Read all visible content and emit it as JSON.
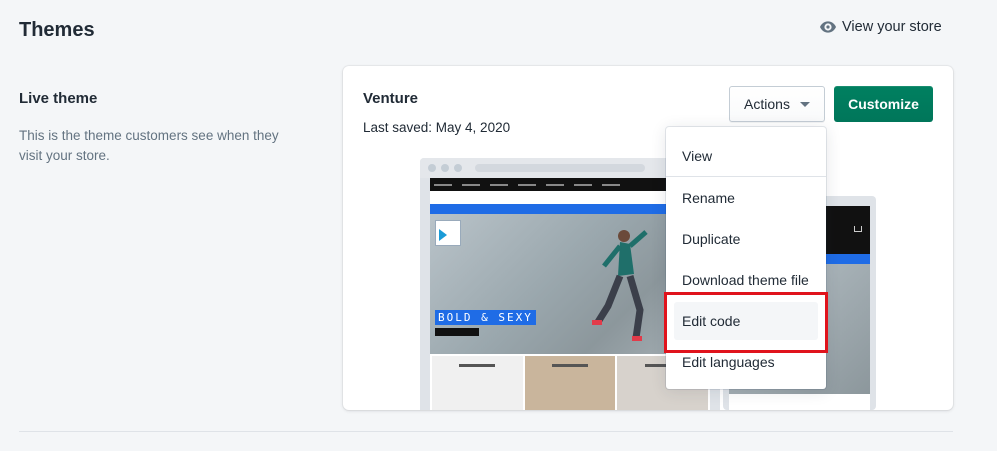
{
  "header": {
    "title": "Themes",
    "view_store_label": "View your store",
    "view_store_icon": "eye-icon"
  },
  "live_theme": {
    "title": "Live theme",
    "description": "This is the theme customers see when they visit your store."
  },
  "theme_card": {
    "name": "Venture",
    "last_saved": "Last saved: May 4, 2020",
    "actions_label": "Actions",
    "customize_label": "Customize"
  },
  "preview": {
    "hero_tag": "BOLD & SEXY"
  },
  "actions_menu": {
    "items": [
      {
        "label": "View"
      },
      {
        "label": "Rename"
      },
      {
        "label": "Duplicate"
      },
      {
        "label": "Download theme file"
      },
      {
        "label": "Edit code",
        "highlighted": true
      },
      {
        "label": "Edit languages"
      }
    ]
  },
  "colors": {
    "primary": "#008060",
    "highlight_box": "#e0131c",
    "background": "#f4f6f8"
  }
}
